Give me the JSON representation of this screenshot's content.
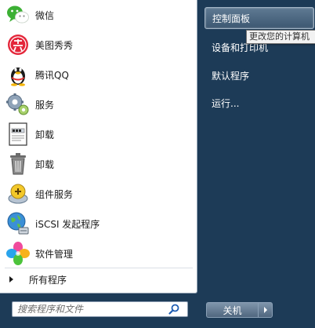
{
  "programs": [
    {
      "label": "微信",
      "icon": "wechat-icon"
    },
    {
      "label": "美图秀秀",
      "icon": "meitu-icon"
    },
    {
      "label": "腾讯QQ",
      "icon": "qq-penguin-icon"
    },
    {
      "label": "服务",
      "icon": "services-gears-icon"
    },
    {
      "label": "卸载",
      "icon": "uninstall-document-icon"
    },
    {
      "label": "卸载",
      "icon": "trash-can-icon"
    },
    {
      "label": "组件服务",
      "icon": "component-services-icon"
    },
    {
      "label": "iSCSI 发起程序",
      "icon": "iscsi-globe-icon"
    },
    {
      "label": "软件管理",
      "icon": "software-manager-clover-icon"
    }
  ],
  "all_programs": "所有程序",
  "search": {
    "placeholder": "搜索程序和文件"
  },
  "right_items": [
    {
      "label": "控制面板"
    },
    {
      "label": "设备和打印机"
    },
    {
      "label": "默认程序"
    },
    {
      "label": "运行..."
    }
  ],
  "tooltip": "更改您的计算机",
  "shutdown": {
    "label": "关机"
  },
  "colors": {
    "right_pane_bg": "#1d3b57",
    "left_pane_bg": "#ffffff",
    "hover_bg": "#4d6883",
    "search_icon": "#1e5db3"
  }
}
